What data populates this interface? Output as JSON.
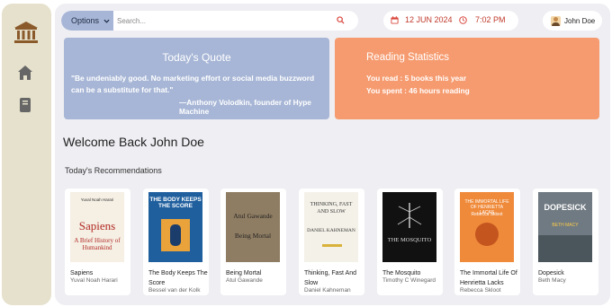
{
  "search": {
    "options_label": "Options",
    "placeholder": "Search..."
  },
  "datetime": {
    "date": "12 JUN 2024",
    "time": "7:02 PM",
    "accent": "#c0392b"
  },
  "user": {
    "name": "John Doe"
  },
  "quote": {
    "title": "Today's Quote",
    "text": "\"Be undeniably good. No marketing effort or social media buzzword can be a substitute for that.\"",
    "author": "—Anthony Volodkin, founder of Hype Machine",
    "color": "#a7b6d6"
  },
  "stats": {
    "title": "Reading Statistics",
    "line1": "You read : 5 books this year",
    "line2": "You spent : 46 hours reading",
    "color": "#f69b6f"
  },
  "welcome": "Welcome Back John Doe",
  "recommendations_title": "Today's Recommendations",
  "books": [
    {
      "title": "Sapiens",
      "author": "Yuval Noah Harari",
      "cover": {
        "top": "Yuval Noah Harari",
        "main": "Sapiens",
        "sub": "A Brief History of Humankind"
      }
    },
    {
      "title": "The Body Keeps The Score",
      "author": "Bessel van der Kolk",
      "cover": {
        "main": "THE BODY KEEPS THE SCORE"
      }
    },
    {
      "title": "Being Mortal",
      "author": "Atul Gawande",
      "cover": {
        "top": "Atul Gawande",
        "main": "Being Mortal"
      }
    },
    {
      "title": "Thinking, Fast And Slow",
      "author": "Daniel Kahneman",
      "cover": {
        "main": "THINKING, FAST AND SLOW",
        "sub": "DANIEL KAHNEMAN"
      }
    },
    {
      "title": "The Mosquito",
      "author": "Timothy C Winegard",
      "cover": {
        "main": "THE MOSQUITO"
      }
    },
    {
      "title": "The Immortal Life Of Henrietta Lacks",
      "author": "Rebecca Skloot",
      "cover": {
        "main": "THE IMMORTAL LIFE OF HENRIETTA LACKS",
        "sub": "Rebecca Skloot"
      }
    },
    {
      "title": "Dopesick",
      "author": "Beth Macy",
      "cover": {
        "main": "DOPESICK",
        "sub": "BETH MACY"
      }
    }
  ]
}
